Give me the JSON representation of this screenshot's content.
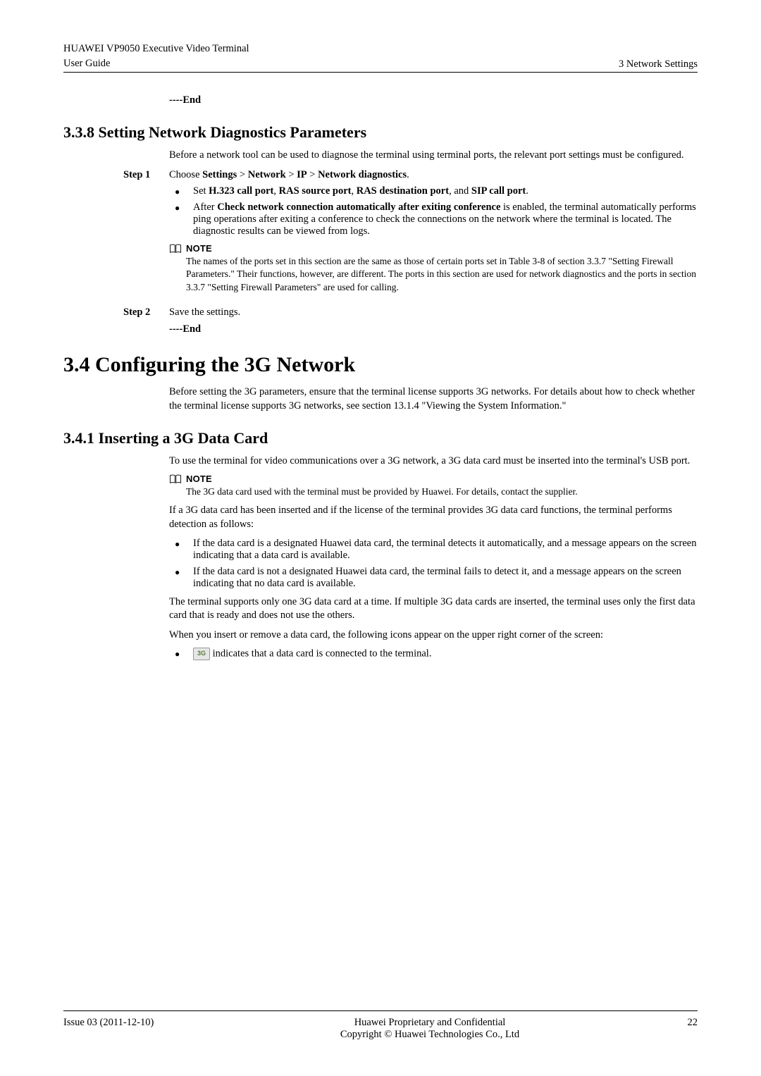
{
  "header": {
    "product": "HUAWEI VP9050 Executive Video Terminal",
    "doc": "User Guide",
    "chapter": "3 Network Settings"
  },
  "preEnd": "----End",
  "section338": {
    "title": "3.3.8 Setting Network Diagnostics Parameters",
    "intro": "Before a network tool can be used to diagnose the terminal using terminal ports, the relevant port settings must be configured.",
    "step1Label": "Step 1",
    "step1Prefix": "Choose ",
    "s1a": "Settings",
    "gt1": " > ",
    "s1b": "Network",
    "gt2": " > ",
    "s1c": "IP",
    "gt3": " > ",
    "s1d": "Network diagnostics",
    "s1end": ".",
    "b1a": "Set ",
    "b1b": "H.323 call port",
    "b1c": ", ",
    "b1d": "RAS source port",
    "b1e": ", ",
    "b1f": "RAS destination port",
    "b1g": ", and ",
    "b1h": "SIP call port",
    "b1i": ".",
    "b2a": "After ",
    "b2b": "Check network connection automatically after exiting conference",
    "b2c": " is enabled, the terminal automatically performs ping operations after exiting a conference to check the connections on the network where the terminal is located. The diagnostic results can be viewed from logs.",
    "noteLabel": "NOTE",
    "noteText": "The names of the ports set in this section are the same as those of certain ports set in Table 3-8 of section 3.3.7 \"Setting Firewall Parameters.\" Their functions, however, are different. The ports in this section are used for network diagnostics and the ports in section 3.3.7 \"Setting Firewall Parameters\" are used for calling.",
    "step2Label": "Step 2",
    "step2Body": "Save the settings.",
    "end": "----End"
  },
  "section34": {
    "title": "3.4 Configuring the 3G Network",
    "intro": "Before setting the 3G parameters, ensure that the terminal license supports 3G networks. For details about how to check whether the terminal license supports 3G networks, see section 13.1.4 \"Viewing the System Information.\""
  },
  "section341": {
    "title": "3.4.1 Inserting a 3G Data Card",
    "p1": "To use the terminal for video communications over a 3G network, a 3G data card must be inserted into the terminal's USB port.",
    "noteLabel": "NOTE",
    "noteText": "The 3G data card used with the terminal must be provided by Huawei. For details, contact the supplier.",
    "p2": "If a 3G data card has been inserted and if the license of the terminal provides 3G data card functions, the terminal performs detection as follows:",
    "b1": "If the data card is a designated Huawei data card, the terminal detects it automatically, and a message appears on the screen indicating that a data card is available.",
    "b2": "If the data card is not a designated Huawei data card, the terminal fails to detect it, and a message appears on the screen indicating that no data card is available.",
    "p3": "The terminal supports only one 3G data card at a time. If multiple 3G data cards are inserted, the terminal uses only the first data card that is ready and does not use the others.",
    "p4": "When you insert or remove a data card, the following icons appear on the upper right corner of the screen:",
    "iconBadge": "3G",
    "iconText": " indicates that a data card is connected to the terminal."
  },
  "footer": {
    "issue": "Issue 03 (2011-12-10)",
    "line1": "Huawei Proprietary and Confidential",
    "line2": "Copyright © Huawei Technologies Co., Ltd",
    "page": "22"
  }
}
